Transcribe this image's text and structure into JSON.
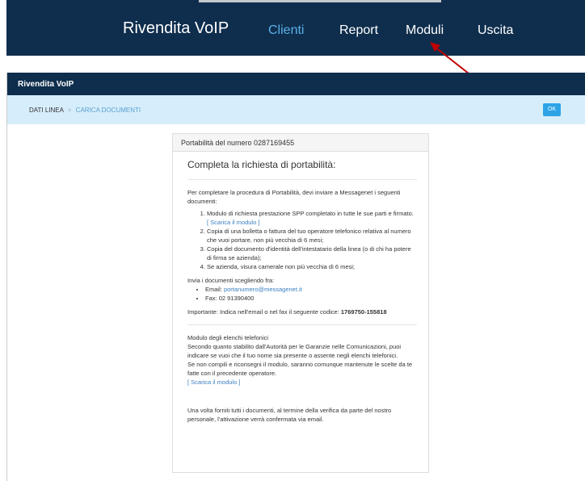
{
  "top_nav": {
    "brand": "Rivendita VoIP",
    "items": [
      "Clienti",
      "Report",
      "Moduli",
      "Uscita"
    ]
  },
  "app_header": {
    "title": "Rivendita VoIP"
  },
  "breadcrumb": {
    "step1": "DATI LINEA",
    "separator": ">",
    "step2": "CARICA DOCUMENTI"
  },
  "ok_button": "OK",
  "card": {
    "header": "Portabilità del numero 0287169455",
    "title": "Completa la richiesta di portabilità:",
    "intro": "Per completare la procedura di Portabilità, devi inviare a Messagenet i seguenti documenti:",
    "steps": [
      "Modulo di richiesta prestazione SPP completato in tutte le sue parti e firmato.",
      "Copia di una bolletta o fattura del tuo operatore telefonico relativa al numero che vuoi portare, non più vecchia di 6 mesi;",
      "Copia del documento d'identità dell'intestatario della linea (o di chi ha potere di firma se azienda);",
      "Se azienda, visura camerale non più vecchia di 6 mesi;"
    ],
    "download_link_1": "[ Scarica il modulo ]",
    "send_intro": "Invia i documenti scegliendo fra:",
    "email_label": "Email:",
    "email_value": "portanumero@messagenet.it",
    "fax_label": "Fax:",
    "fax_value": "02 91390400",
    "important_text": "Importante: Indica nell'email o nel fax il seguente codice:",
    "important_code": "1769750-155818",
    "elenchi_title": "Modulo degli elenchi telefonici",
    "elenchi_text_1": "Secondo quanto stabilito dall'Autorità per le Garanzie nelle Comunicazioni, puoi indicare se vuoi che il tuo nome sia presente o assente negli elenchi telefonici.",
    "elenchi_text_2": "Se non compili e riconsegni il modulo, saranno comunque mantenute le scelte da te fatte con il precedente operatore.",
    "download_link_2": "[ Scarica il modulo ]",
    "final_text": "Una volta forniti tutti i documenti, al termine della verifica da parte del nostro personale, l'attivazione verrà confermata via email."
  },
  "colors": {
    "nav_bg": "#0f2e4d",
    "accent": "#5ab0e8",
    "breadcrumb_bg": "#d6eefb",
    "ok_bg": "#2ea3e6",
    "arrow": "#c00000"
  }
}
